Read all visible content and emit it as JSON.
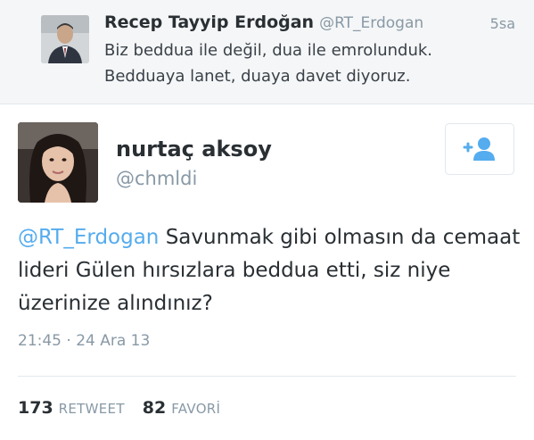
{
  "parent_tweet": {
    "name": "Recep Tayyip Erdoğan",
    "handle": "@RT_Erdogan",
    "time": "5sa",
    "text_line1": "Biz beddua ile değil, dua ile emrolunduk.",
    "text_line2": "Bedduaya lanet, duaya davet diyoruz."
  },
  "tweet": {
    "name": "nurtaç aksoy",
    "handle": "@chmldi",
    "mention": "@RT_Erdogan",
    "text": " Savunmak gibi olmasın da cemaat lideri Gülen hırsızlara beddua etti, siz niye üzerinize alındınız?",
    "timestamp": "21:45 · 24 Ara 13",
    "follow_icon": "add-user-icon"
  },
  "stats": {
    "retweets_count": "173",
    "retweets_label": "RETWEET",
    "favorites_count": "82",
    "favorites_label": "FAVORİ"
  },
  "colors": {
    "link": "#55acee",
    "secondary_text": "#8899a6",
    "parent_background": "#f5f6f7"
  }
}
